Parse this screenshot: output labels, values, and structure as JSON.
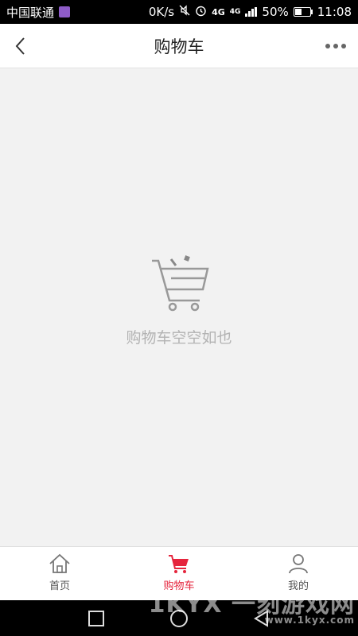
{
  "status_bar": {
    "carrier": "中国联通",
    "speed": "0K/s",
    "network": "4G",
    "network2": "4G",
    "battery": "50%",
    "battery_level": 0.5,
    "time": "11:08"
  },
  "header": {
    "title": "购物车",
    "back_icon": "chevron-left-icon",
    "more_icon": "more-dots-icon"
  },
  "empty_state": {
    "icon": "shopping-cart-icon",
    "message": "购物车空空如也"
  },
  "tabs": [
    {
      "label": "首页",
      "icon": "home-icon",
      "active": false
    },
    {
      "label": "购物车",
      "icon": "shopping-cart-icon",
      "active": true
    },
    {
      "label": "我的",
      "icon": "user-icon",
      "active": false
    }
  ],
  "colors": {
    "accent": "#e5243c",
    "background": "#f2f2f2",
    "muted_text": "#b3b3b3"
  },
  "watermark": {
    "brand": "1KYX 一刻游戏网",
    "url": "www.1kyx.com"
  }
}
